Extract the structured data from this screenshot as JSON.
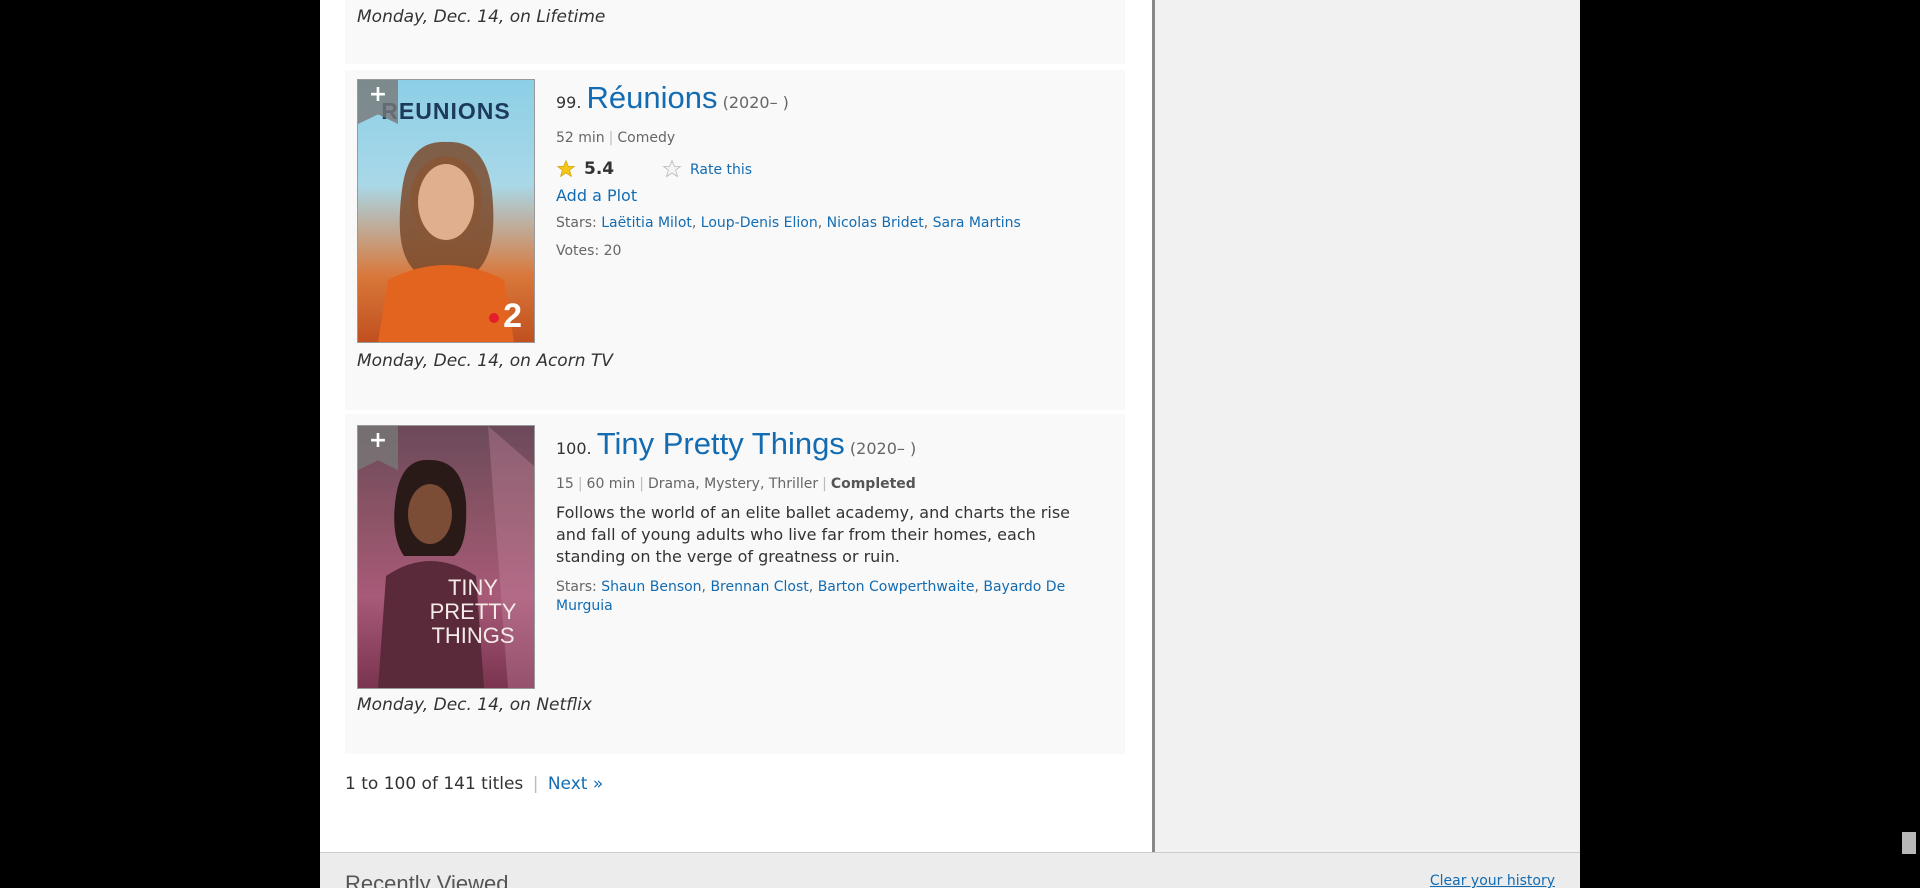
{
  "prev_item": {
    "air_info": "Monday, Dec. 14, on Lifetime"
  },
  "items": [
    {
      "number": "99.",
      "title": "Réunions",
      "year": "(2020– )",
      "runtime": "52 min",
      "genres": "Comedy",
      "rating": "5.4",
      "rate_label": "Rate this",
      "plot_link": "Add a Plot",
      "stars_label": "Stars:",
      "stars": [
        "Laëtitia Milot",
        "Loup-Denis Elion",
        "Nicolas Bridet",
        "Sara Martins"
      ],
      "votes_label": "Votes:",
      "votes": "20",
      "poster_text": "REUNIONS",
      "poster_badge": "2",
      "air_info": "Monday, Dec. 14, on Acorn TV"
    },
    {
      "number": "100.",
      "title": "Tiny Pretty Things",
      "year": "(2020– )",
      "certificate": "15",
      "runtime": "60 min",
      "genres": "Drama, Mystery, Thriller",
      "status": "Completed",
      "plot": "Follows the world of an elite ballet academy, and charts the rise and fall of young adults who live far from their homes, each standing on the verge of greatness or ruin.",
      "stars_label": "Stars:",
      "stars": [
        "Shaun Benson",
        "Brennan Clost",
        "Barton Cowperthwaite",
        "Bayardo De Murguia"
      ],
      "poster_text": [
        "TINY",
        "PRETTY",
        "THINGS"
      ],
      "air_info": "Monday, Dec. 14, on Netflix"
    }
  ],
  "pagination": {
    "summary": "1 to 100 of 141 titles",
    "next": "Next »"
  },
  "recently_viewed": {
    "title": "Recently Viewed",
    "clear": "Clear your history"
  },
  "colors": {
    "link": "#136cb2",
    "star": "#f5c518",
    "background": "#000000"
  }
}
